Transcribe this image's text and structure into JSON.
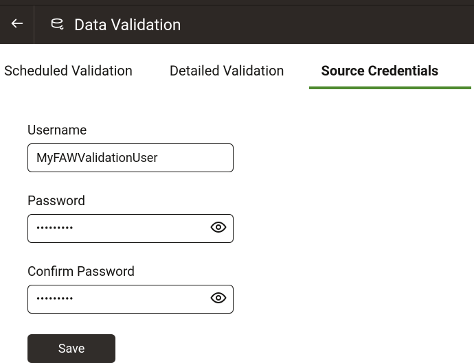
{
  "header": {
    "title": "Data Validation"
  },
  "tabs": {
    "scheduled": "Scheduled Validation",
    "detailed": "Detailed Validation",
    "source_credentials": "Source Credentials"
  },
  "form": {
    "username_label": "Username",
    "username_value": "MyFAWValidationUser",
    "password_label": "Password",
    "password_value": "•••••••••",
    "confirm_password_label": "Confirm Password",
    "confirm_password_value": "•••••••••",
    "save_label": "Save"
  }
}
